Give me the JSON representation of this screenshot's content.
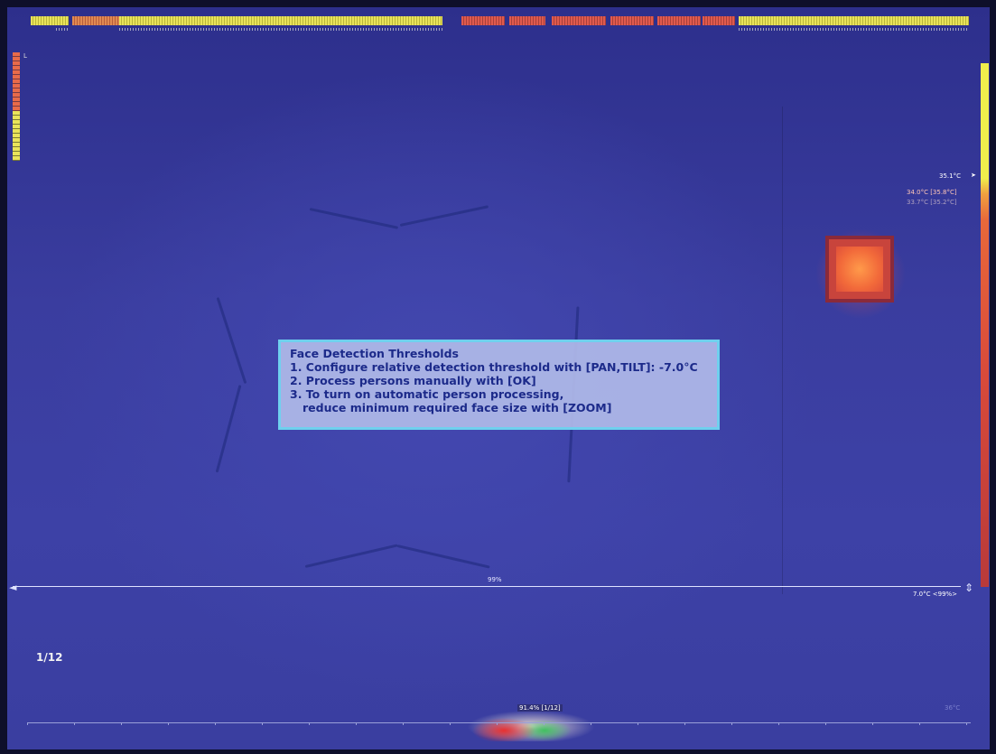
{
  "dialog": {
    "title": "Face Detection Thresholds",
    "line1": "1. Configure relative detection threshold with [PAN,TILT]: -7.0°C",
    "line2": "2. Process persons manually with [OK]",
    "line3": "3. To turn on automatic person processing,",
    "line4": "reduce minimum required face size with [ZOOM]"
  },
  "overlay": {
    "page_counter": "1/12",
    "threshold_percent": "99%",
    "threshold_readout": "7.0°C <99%>",
    "left_meter_label": "L"
  },
  "scale": {
    "top_temp": "35.1°C",
    "alarm_temp": "34.0°C [35.8°C]",
    "secondary_temp": "33.7°C [35.2°C]"
  },
  "histogram": {
    "label": "91.4% [1/12]",
    "right_label": "36°C"
  },
  "colors": {
    "background": "#3a3d9f",
    "dialog_bg": "#afb9e8",
    "dialog_border": "#6fd0ee",
    "dialog_text": "#1c2a8a",
    "hot_object": "#f26a3a"
  },
  "icons": {
    "left_arrow": "arrow-left-icon",
    "right_indicator": "arrow-right-icon",
    "pan_tilt": "up-down-arrows-icon"
  }
}
